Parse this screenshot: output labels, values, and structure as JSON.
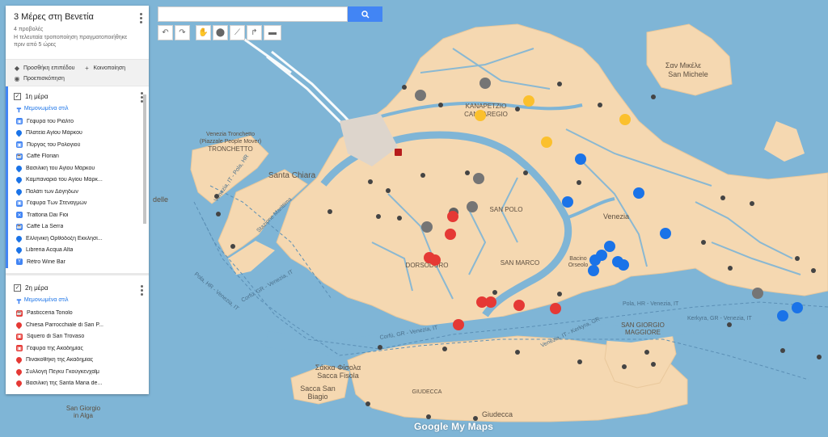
{
  "panel": {
    "map_title": "3 Μέρες στη Βενετία",
    "views": "4 προβολές",
    "last_modified_line1": "Η τελευταία τροποποίηση πραγματοποιήθηκε",
    "last_modified_line2": "πριν από 5 ώρες",
    "actions": {
      "add_layer": "Προσθήκη επιπέδου",
      "share": "Κοινοποίηση",
      "preview": "Προεπισκόπηση"
    },
    "layers": [
      {
        "title": "1η μέρα",
        "style_label": "Μεμονωμένα στιλ",
        "items": [
          {
            "label": "Γέφυρα του Ριάλτο",
            "icon": "camera-icon",
            "color": "#4285f4"
          },
          {
            "label": "Πλατεία Αγίου Μάρκου",
            "icon": "pin-icon",
            "color": "#1a73e8"
          },
          {
            "label": "Πύργος του Ρολογιού",
            "icon": "camera-icon",
            "color": "#4285f4"
          },
          {
            "label": "Caffè Florian",
            "icon": "coffee-icon",
            "color": "#4285f4"
          },
          {
            "label": "Βασιλική του Αγίου Μάρκου",
            "icon": "pin-icon",
            "color": "#1a73e8"
          },
          {
            "label": "Καμπαναριό του Αγίου Μάρκ...",
            "icon": "pin-icon",
            "color": "#1a73e8"
          },
          {
            "label": "Παλάτι των Δόγηδων",
            "icon": "pin-icon",
            "color": "#1a73e8"
          },
          {
            "label": "Γέφυρα Των Στεναγμών",
            "icon": "camera-icon",
            "color": "#4285f4"
          },
          {
            "label": "Trattoria Dai Fioi",
            "icon": "restaurant-icon",
            "color": "#4285f4"
          },
          {
            "label": "Caffè La Serra",
            "icon": "coffee-icon",
            "color": "#4285f4"
          },
          {
            "label": "Ελληνική Ορθόδοξη Εκκλησί...",
            "icon": "pin-icon",
            "color": "#1a73e8"
          },
          {
            "label": "Libreria Acqua Alta",
            "icon": "pin-icon",
            "color": "#1a73e8"
          },
          {
            "label": "Rètro Wine Bar",
            "icon": "bar-icon",
            "color": "#4285f4"
          }
        ]
      },
      {
        "title": "2η μέρα",
        "style_label": "Μεμονωμένα στιλ",
        "items": [
          {
            "label": "Pasticceria Tonolo",
            "icon": "coffee-icon",
            "color": "#e53935"
          },
          {
            "label": "Chiesa Parrocchiale di San P...",
            "icon": "pin-icon",
            "color": "#e53935"
          },
          {
            "label": "Squero di San Trovaso",
            "icon": "camera-icon",
            "color": "#e53935"
          },
          {
            "label": "Γέφυρα της Ακαδημίας",
            "icon": "camera-icon",
            "color": "#e53935"
          },
          {
            "label": "Πινακοθήκη της Ακαδημίας",
            "icon": "pin-icon",
            "color": "#e53935"
          },
          {
            "label": "Συλλογή Πέγκυ Γκούγκενχαϊμ",
            "icon": "pin-icon",
            "color": "#e53935"
          },
          {
            "label": "Βασιλική της Santa Maria de...",
            "icon": "pin-icon",
            "color": "#e53935"
          }
        ]
      }
    ]
  },
  "map": {
    "labels": {
      "san_michele_gr": "Σαν Μικέλε",
      "san_michele": "San Michele",
      "cannaregio_gr": "ΚΑΝΑΡΕΤΖΙΟ",
      "cannaregio": "CANNAREGIO",
      "tronchetto_parking": "Venezia Tronchetto",
      "tronchetto_parking2": "(Piazzale People Mover)",
      "tronchetto": "TRONCHETTO",
      "santa_chiara": "Santa Chiara",
      "san_polo": "SAN POLO",
      "venezia": "Venezia",
      "dorsoduro": "DORSODURO",
      "san_marco": "SAN MARCO",
      "san_giorgio": "SAN GIORGIO",
      "maggiore": "MAGGIORE",
      "sacca_fisola_gr": "Σάκκα Φίσολα",
      "sacca_fisola": "Sacca Fisola",
      "sacca_san_biagio_1": "Sacca San",
      "sacca_san_biagio_2": "Biagio",
      "giudecca_upper": "GIUDECCA",
      "giudecca": "Giudecca",
      "san_giorgio_alga_1": "San Giorgio",
      "san_giorgio_alga_2": "in Alga",
      "delle": "delle",
      "bacino_orseolo_1": "Bacino",
      "bacino_orseolo_2": "Orseolo",
      "ferry_route": "Venezia, IT - Pola, HR",
      "ferry_route2": "Venezia, IT - Rabac, HR",
      "ferry_route3": "Corfù, GR - Venezia, IT",
      "ferry_route4": "Venezia, IT - Kerkyra, GR",
      "ferry_route5": "Pola, HR - Venezia, IT",
      "ferry_route6": "Kerkyra, GR - Venezia, IT",
      "street_tronchetto": "Isola del Tronchetto",
      "street_marittima": "Stazione Marittima"
    },
    "attribution": "Google My Maps"
  },
  "toolbar": {
    "undo": "undo-icon",
    "redo": "redo-icon",
    "pan": "hand-icon",
    "marker": "marker-icon",
    "line": "line-icon",
    "directions": "directions-icon",
    "measure": "ruler-icon"
  }
}
